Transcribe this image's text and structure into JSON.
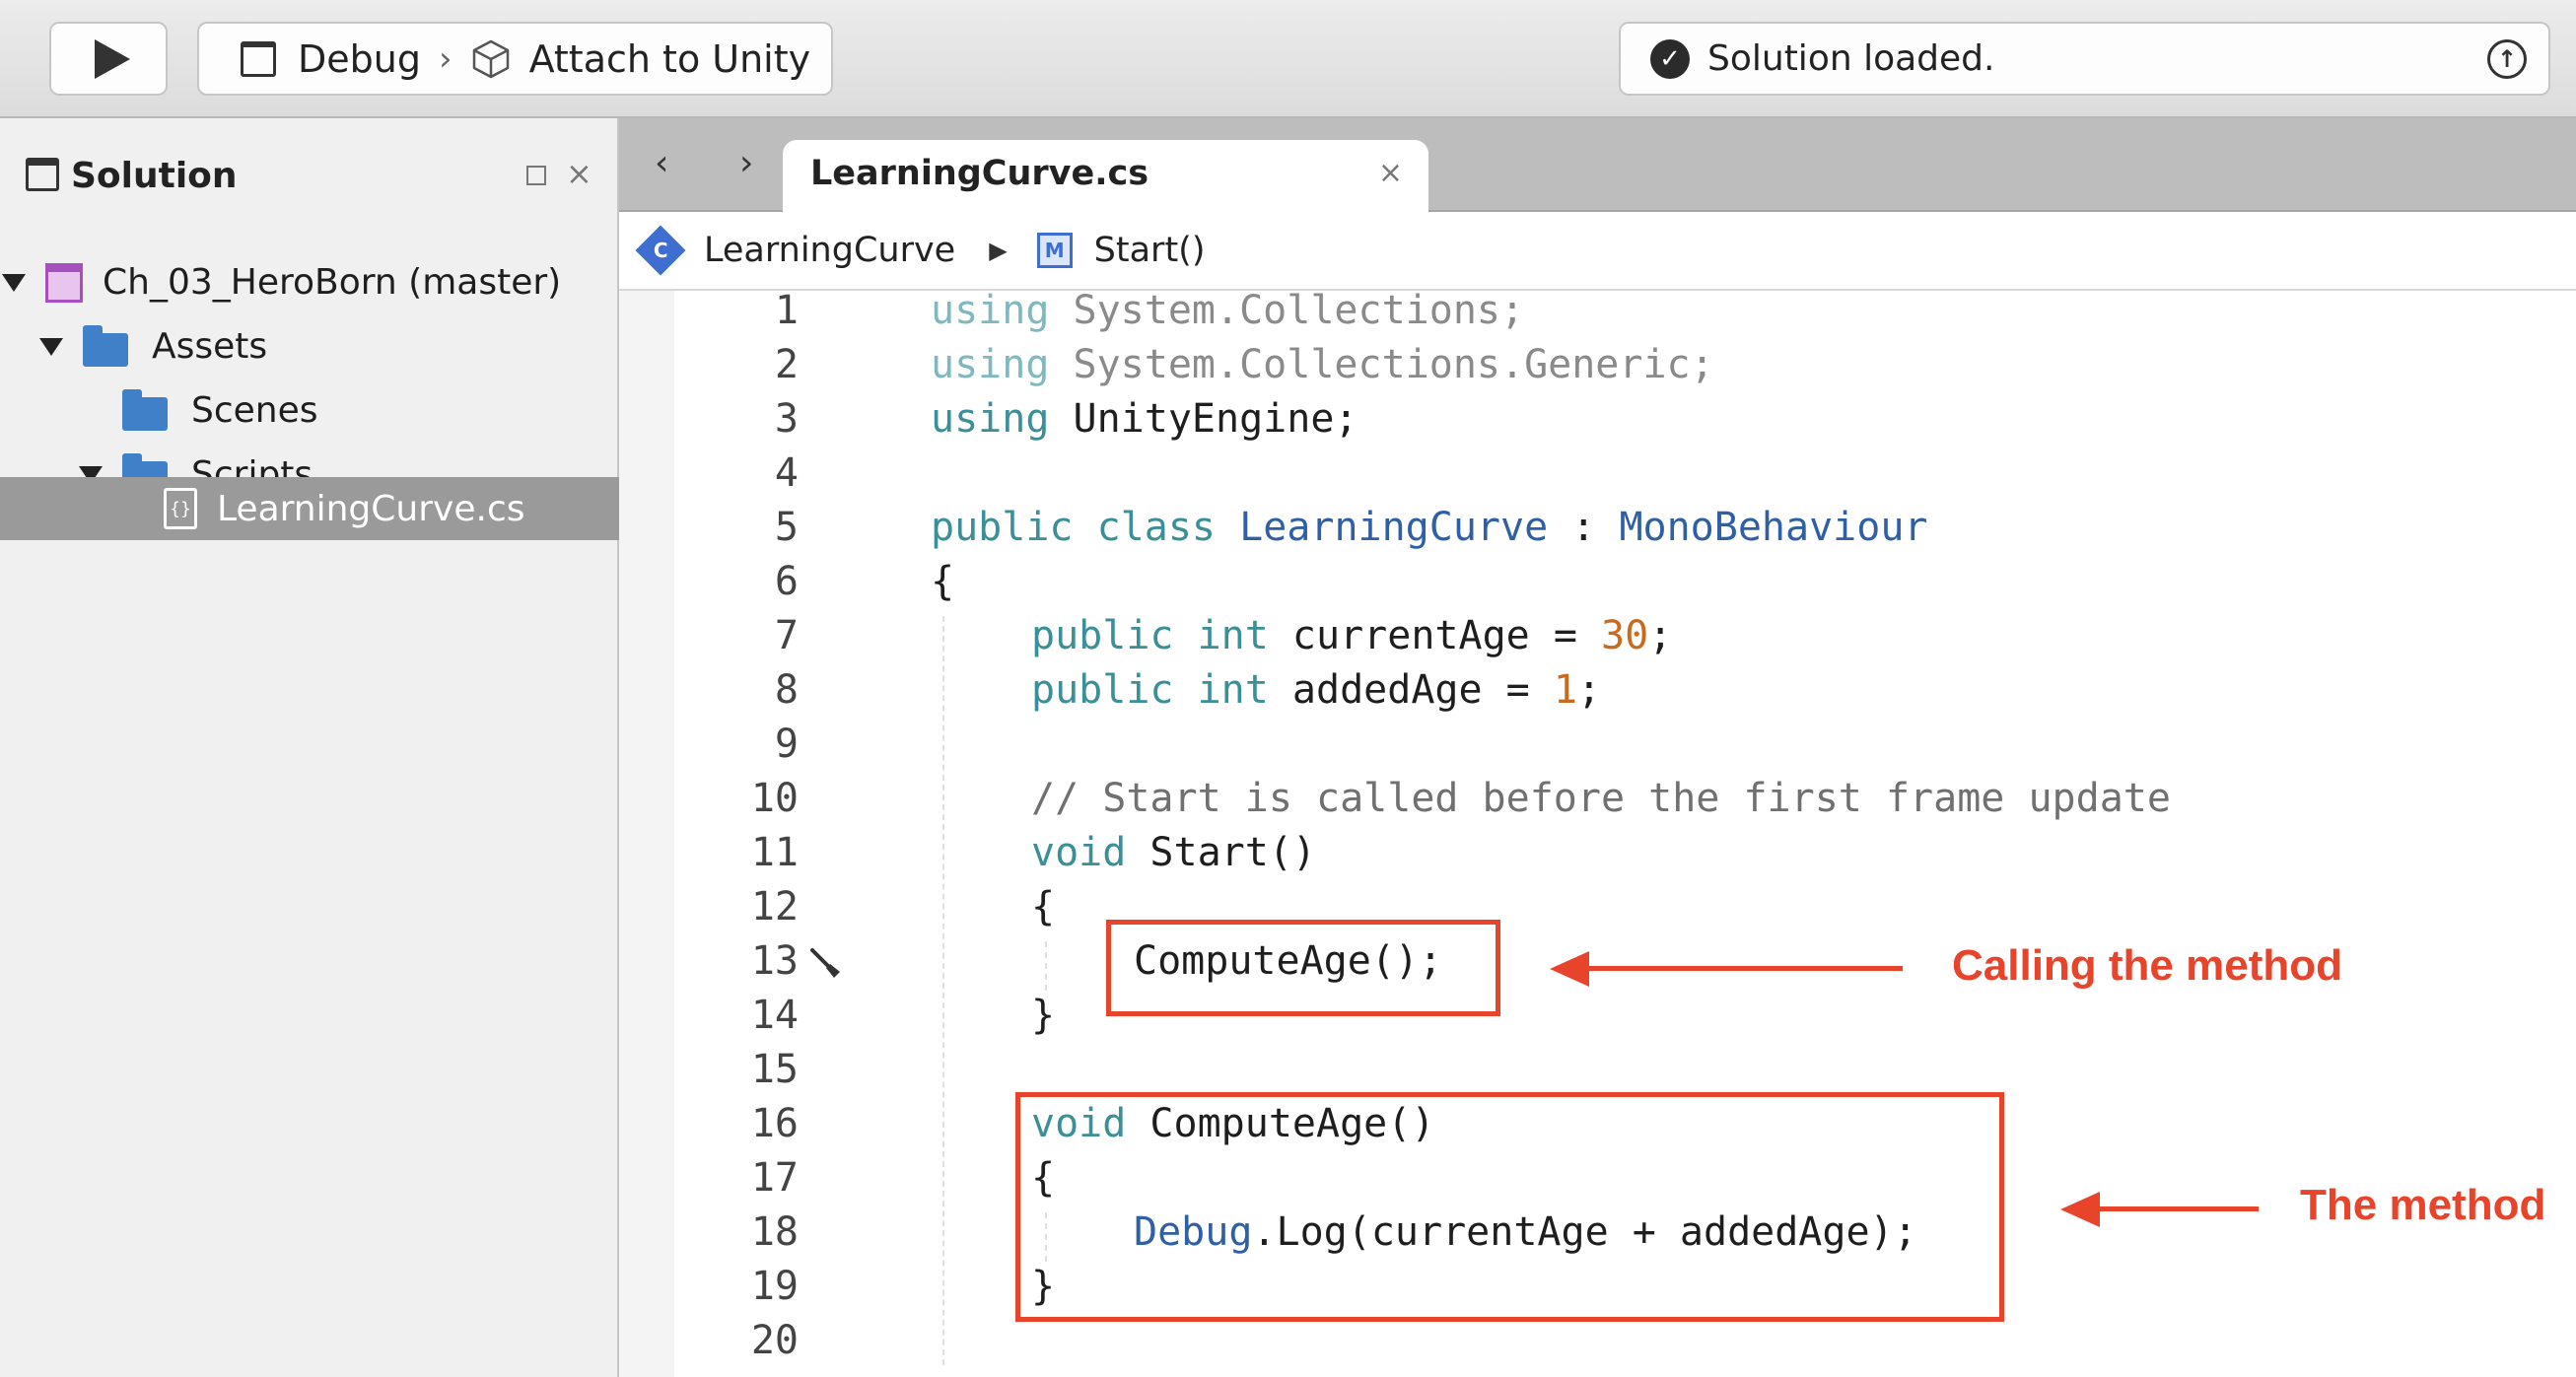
{
  "toolbar": {
    "run_icon": "play-icon",
    "configuration": "Debug",
    "target": "Attach to Unity",
    "status": "Solution loaded."
  },
  "solution_pad": {
    "title": "Solution",
    "items": [
      {
        "label": "Ch_03_HeroBorn (master)",
        "kind": "project",
        "expanded": true
      },
      {
        "label": "Assets",
        "kind": "folder",
        "expanded": true
      },
      {
        "label": "Scenes",
        "kind": "folder",
        "expanded": false
      },
      {
        "label": "Scripts",
        "kind": "folder",
        "expanded": true
      },
      {
        "label": "LearningCurve.cs",
        "kind": "csharp-file",
        "selected": true
      }
    ]
  },
  "editor": {
    "tab_label": "LearningCurve.cs",
    "path": {
      "class_name": "LearningCurve",
      "method_name": "Start()"
    },
    "line_numbers": [
      "1",
      "2",
      "3",
      "4",
      "5",
      "6",
      "7",
      "8",
      "9",
      "10",
      "11",
      "12",
      "13",
      "14",
      "15",
      "16",
      "17",
      "18",
      "19",
      "20"
    ],
    "lines": {
      "l1": {
        "kw": "using",
        "rest": " System.Collections;"
      },
      "l2": {
        "kw": "using",
        "rest": " System.Collections.Generic;"
      },
      "l3": {
        "kw": "using",
        "rest": " UnityEngine;"
      },
      "l5": {
        "kw1": "public",
        "kw2": "class",
        "name": "LearningCurve",
        "colon": " : ",
        "base": "MonoBehaviour"
      },
      "l6": "{",
      "l7": {
        "kw1": "public",
        "kw2": "int",
        "name": " currentAge = ",
        "num": "30",
        "end": ";"
      },
      "l8": {
        "kw1": "public",
        "kw2": "int",
        "name": " addedAge = ",
        "num": "1",
        "end": ";"
      },
      "l10": "// Start is called before the first frame update",
      "l11": {
        "kw": "void",
        "rest": " Start()"
      },
      "l12": "{",
      "l13": "ComputeAge();",
      "l14": "}",
      "l16": {
        "kw": "void",
        "rest": " ComputeAge()"
      },
      "l17": "{",
      "l18": {
        "type": "Debug",
        "rest": ".Log(currentAge + addedAge);"
      },
      "l19": "}"
    }
  },
  "annotations": {
    "call_label": "Calling the method",
    "method_label": "The method",
    "color": "#e8442b"
  }
}
